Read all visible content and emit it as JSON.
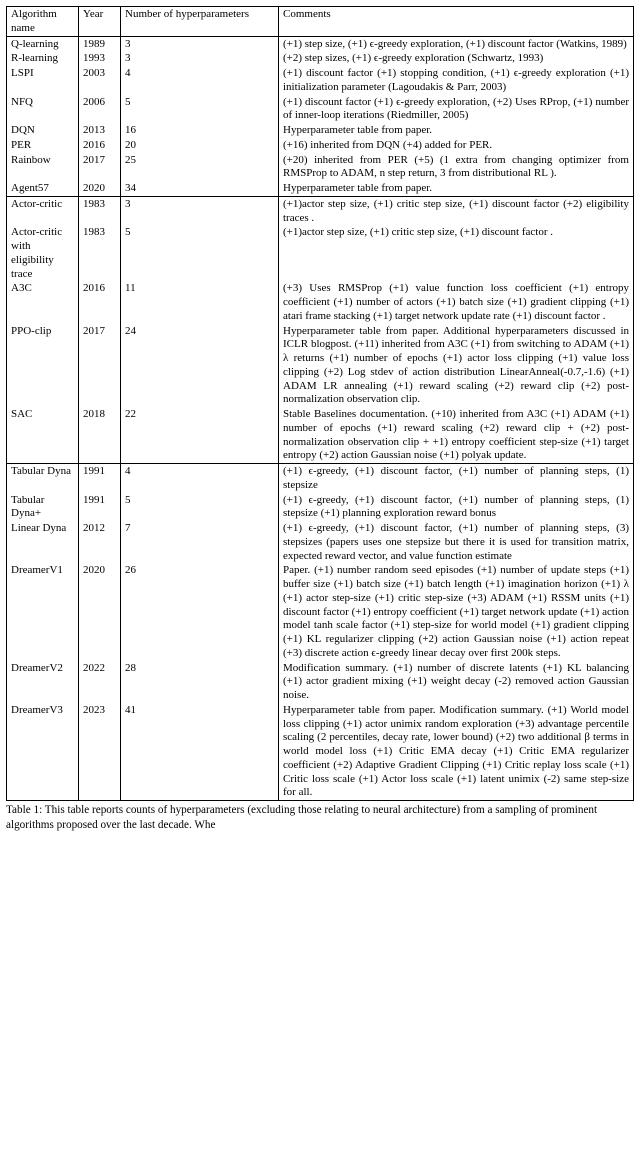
{
  "headers": {
    "algo": "Algorithm name",
    "year": "Year",
    "nhp": "Number of hyperparameters",
    "comments": "Comments"
  },
  "sections": [
    {
      "rows": [
        {
          "name": "Q-learning",
          "year": "1989",
          "n": "3",
          "c": "(+1) step size, (+1) ϵ-greedy exploration, (+1) discount factor (Watkins, 1989)"
        },
        {
          "name": "R-learning",
          "year": "1993",
          "n": "3",
          "c": "(+2) step sizes, (+1) ϵ-greedy exploration (Schwartz, 1993)"
        },
        {
          "name": "LSPI",
          "year": "2003",
          "n": "4",
          "c": "(+1) discount factor (+1) stopping condition, (+1) ϵ-greedy exploration (+1) initialization parameter (Lagoudakis & Parr, 2003)"
        },
        {
          "name": "NFQ",
          "year": "2006",
          "n": "5",
          "c": "(+1) discount factor (+1) ϵ-greedy exploration, (+2) Uses RProp, (+1) number of inner-loop iterations (Riedmiller, 2005)"
        },
        {
          "name": "DQN",
          "year": "2013",
          "n": "16",
          "c": "Hyperparameter table from paper."
        },
        {
          "name": "PER",
          "year": "2016",
          "n": "20",
          "c": "(+16) inherited from DQN (+4) added for PER."
        },
        {
          "name": "Rainbow",
          "year": "2017",
          "n": "25",
          "c": "(+20) inherited from PER (+5) (1 extra from changing optimizer from RMSProp to ADAM, n step return, 3 from distributional RL )."
        },
        {
          "name": "Agent57",
          "year": "2020",
          "n": "34",
          "c": "Hyperparameter table from paper."
        }
      ]
    },
    {
      "rows": [
        {
          "name": "Actor-critic",
          "year": "1983",
          "n": "3",
          "c": " (+1)actor step size, (+1) critic step size, (+1) discount factor (+2) eligibility traces ."
        },
        {
          "name": "Actor-critic with eligibility trace",
          "year": "1983",
          "n": "5",
          "c": " (+1)actor step size, (+1) critic step size, (+1) discount factor ."
        },
        {
          "name": "A3C",
          "year": "2016",
          "n": "11",
          "c": "(+3) Uses RMSProp (+1) value function loss coefficient (+1) entropy coefficient (+1) number of actors (+1) batch size (+1) gradient clipping (+1) atari frame stacking (+1) target network update rate (+1) discount factor ."
        },
        {
          "name": "PPO-clip",
          "year": "2017",
          "n": "24",
          "c": "Hyperparameter table from paper. Additional hyperparameters discussed in ICLR blogpost. (+11) inherited from A3C (+1) from switching to ADAM (+1) λ returns (+1) number of epochs (+1) actor loss clipping (+1) value loss clipping (+2) Log stdev of action distribution LinearAnneal(-0.7,-1.6) (+1) ADAM LR annealing (+1) reward scaling (+2) reward clip (+2) post-normalization observation clip."
        },
        {
          "name": "SAC",
          "year": "2018",
          "n": "22",
          "c": "Stable Baselines documentation. (+10) inherited from A3C (+1) ADAM (+1) number of epochs (+1) reward scaling (+2) reward clip + (+2) post-normalization observation clip + +1) entropy coefficient step-size (+1) target entropy (+2) action Gaussian noise (+1) polyak update."
        }
      ]
    },
    {
      "rows": [
        {
          "name": "Tabular Dyna",
          "year": "1991",
          "n": "4",
          "c": "(+1) ϵ-greedy, (+1) discount factor, (+1) number of planning steps, (1) stepsize"
        },
        {
          "name": "Tabular Dyna+",
          "year": "1991",
          "n": "5",
          "c": "(+1) ϵ-greedy, (+1) discount factor, (+1) number of planning steps, (1) stepsize (+1) planning exploration reward bonus"
        },
        {
          "name": "Linear Dyna",
          "year": "2012",
          "n": "7",
          "c": "(+1) ϵ-greedy, (+1) discount factor, (+1) number of planning steps, (3) stepsizes (papers uses one stepsize but there it is used for transition matrix, expected reward vector, and value function estimate"
        },
        {
          "name": "DreamerV1",
          "year": "2020",
          "n": "26",
          "c": "Paper. (+1) number random seed episodes (+1) number of update steps (+1) buffer size (+1) batch size (+1) batch length (+1) imagination horizon (+1) λ (+1) actor step-size (+1) critic step-size (+3) ADAM (+1) RSSM units (+1) discount factor (+1) entropy coefficient (+1) target network update (+1) action model tanh scale factor (+1) step-size for world model (+1) gradient clipping (+1) KL regularizer clipping (+2) action Gaussian noise (+1) action repeat (+3) discrete action ϵ-greedy linear decay over first 200k steps."
        },
        {
          "name": "DreamerV2",
          "year": "2022",
          "n": "28",
          "c": "Modification summary. (+1) number of discrete latents (+1) KL balancing (+1) actor gradient mixing (+1) weight decay (-2) removed action Gaussian noise."
        },
        {
          "name": "DreamerV3",
          "year": "2023",
          "n": "41",
          "c": "Hyperparameter table from paper. Modification summary. (+1) World model loss clipping (+1) actor unimix random exploration (+3) advantage percentile scaling (2 percentiles, decay rate, lower bound) (+2) two additional β terms in world model loss (+1) Critic EMA decay (+1) Critic EMA regularizer coefficient (+2) Adaptive Gradient Clipping (+1) Critic replay loss scale (+1) Critic loss scale (+1) Actor loss scale (+1) latent unimix (-2) same step-size for all."
        }
      ]
    }
  ],
  "caption": "Table 1: This table reports counts of hyperparameters (excluding those relating to neural architecture) from a sampling of prominent algorithms proposed over the last decade. Whe"
}
